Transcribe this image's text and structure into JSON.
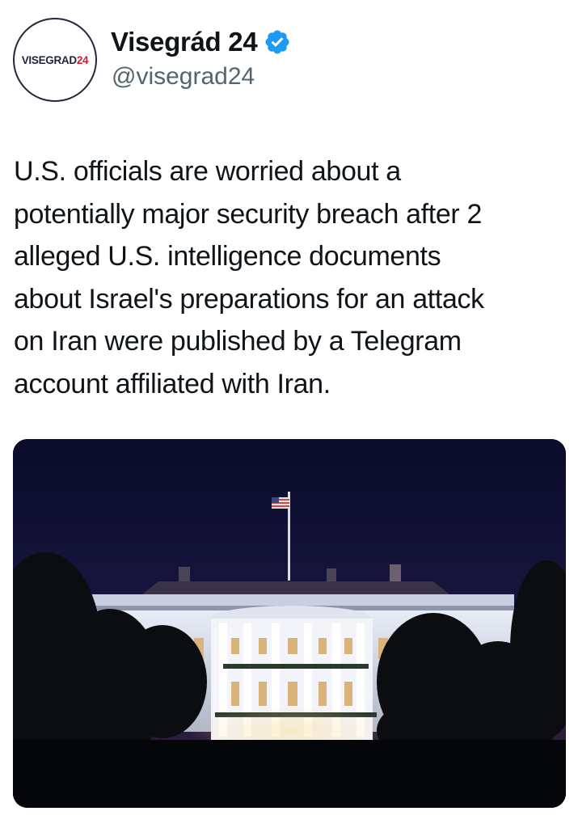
{
  "account": {
    "display_name": "Visegrád 24",
    "handle": "@visegrad24",
    "avatar_text_main": "VISEGRAD",
    "avatar_text_num": "24",
    "verified_icon": "verified-badge-icon"
  },
  "tweet": {
    "text": "U.S. officials are worried about a\npotentially major security breach after 2\nalleged U.S. intelligence documents\nabout Israel's preparations for an attack\non Iran were published by a Telegram\naccount affiliated with Iran."
  },
  "media": {
    "description_icon": "white-house-at-night-photo"
  },
  "colors": {
    "text_primary": "#0f1419",
    "text_secondary": "#536471",
    "verified_blue": "#1d9bf0",
    "avatar_red": "#c8202f",
    "avatar_navy": "#1f2340"
  }
}
